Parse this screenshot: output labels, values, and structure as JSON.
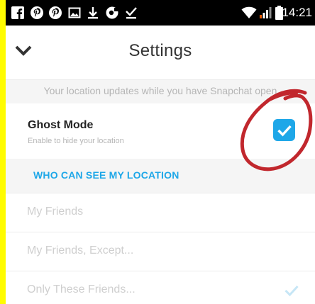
{
  "status_bar": {
    "time": "14:21",
    "left_icons": [
      "facebook-icon",
      "pinterest-icon",
      "pinterest-icon",
      "image-icon",
      "download-icon",
      "app-icon",
      "download-done-icon"
    ],
    "right_icons": [
      "wifi-icon",
      "signal-icon",
      "battery-icon"
    ]
  },
  "header": {
    "title": "Settings",
    "back_icon": "chevron-down-icon"
  },
  "notice": {
    "text": "Your location updates while you have Snapchat open"
  },
  "ghost_mode": {
    "title": "Ghost Mode",
    "subtitle": "Enable to hide your location",
    "checked": true
  },
  "section": {
    "label": "WHO CAN SEE MY LOCATION"
  },
  "options": [
    {
      "label": "My Friends",
      "selected": false
    },
    {
      "label": "My Friends, Except...",
      "selected": false
    },
    {
      "label": "Only These Friends...",
      "selected": true
    }
  ],
  "colors": {
    "accent": "#1ea7e8",
    "frame": "#fffc00",
    "annotation": "#c1272d",
    "muted_text": "#b5b5b5"
  }
}
